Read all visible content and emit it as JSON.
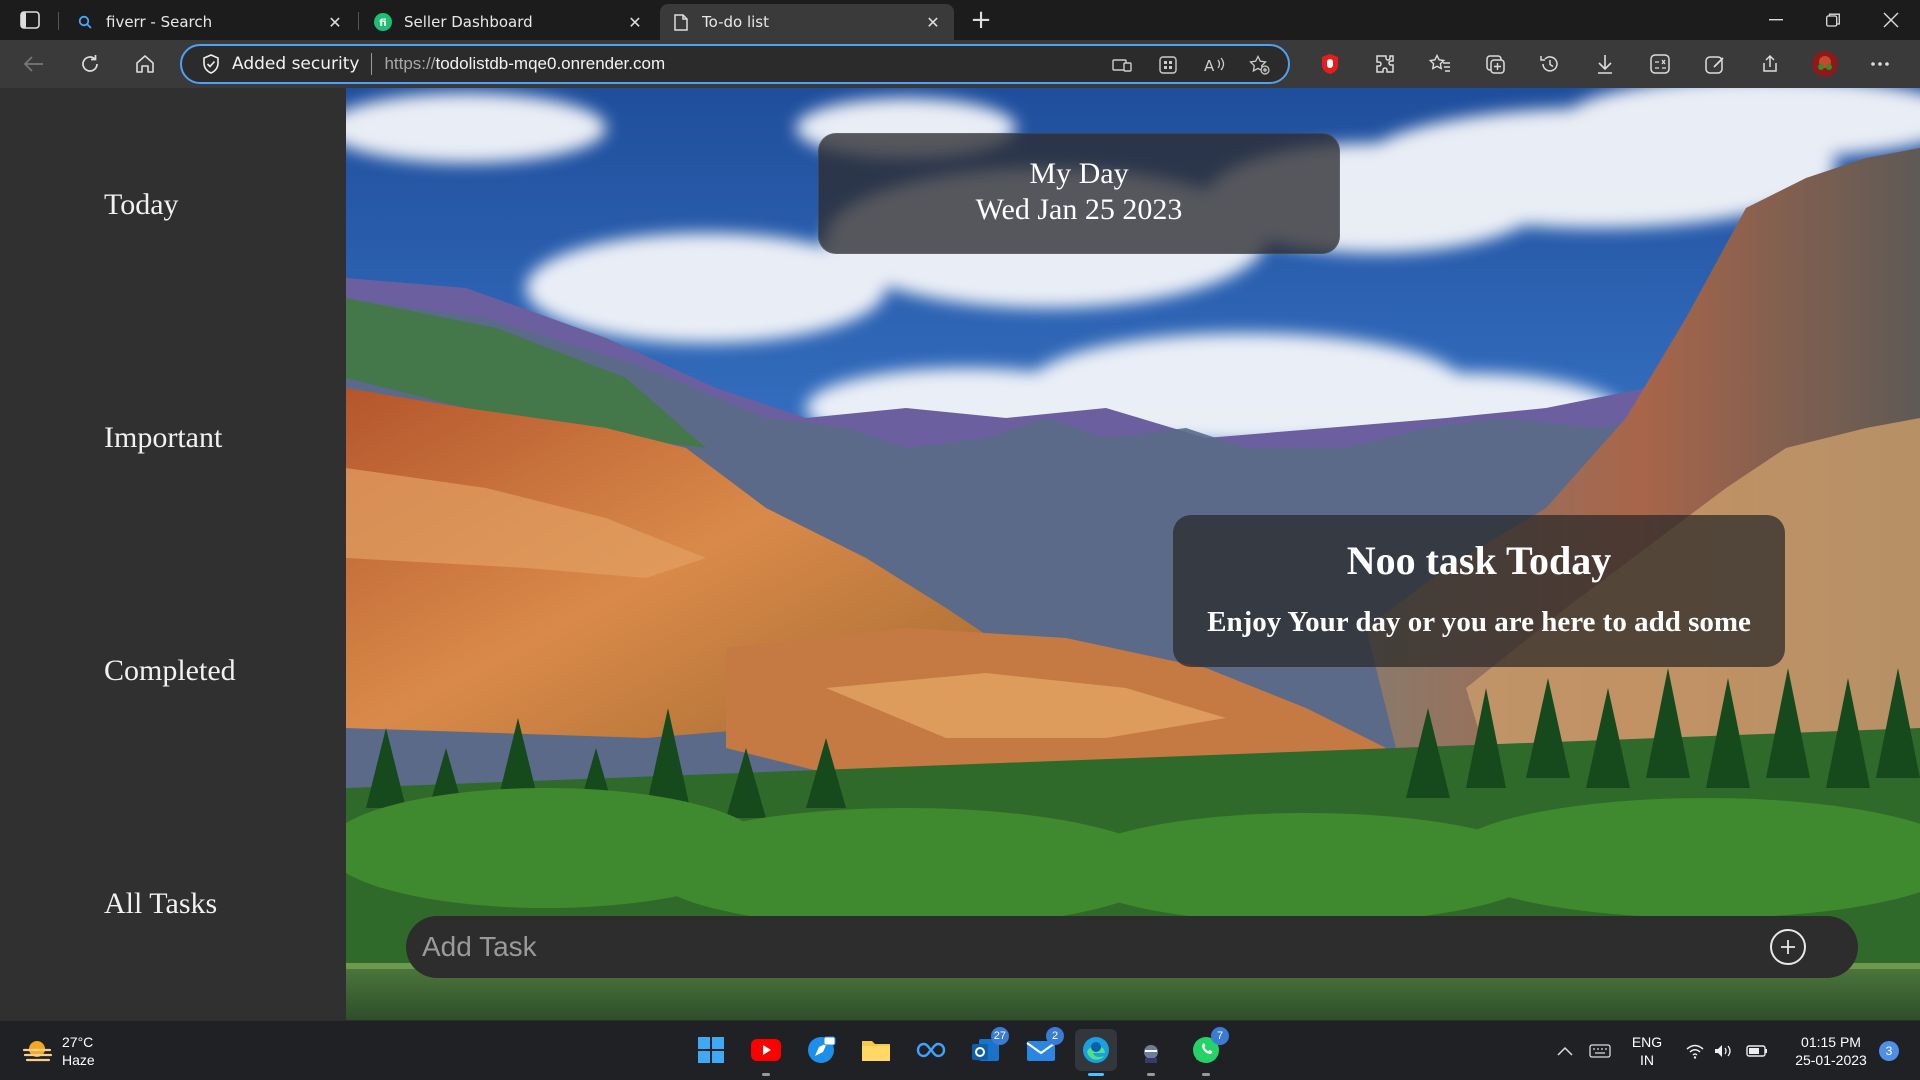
{
  "browser": {
    "tabs": [
      {
        "title": "fiverr - Search",
        "icon": "search-icon",
        "active": false
      },
      {
        "title": "Seller Dashboard",
        "icon": "fiverr-icon",
        "active": false
      },
      {
        "title": "To-do list",
        "icon": "page-icon",
        "active": true
      }
    ],
    "security_label": "Added security",
    "url_scheme": "https://",
    "url_host": "todolistdb-mqe0.onrender.com"
  },
  "sidebar": {
    "items": [
      {
        "label": "Today"
      },
      {
        "label": "Important"
      },
      {
        "label": "Completed"
      },
      {
        "label": "All Tasks"
      }
    ]
  },
  "header": {
    "title": "My Day",
    "date": "Wed Jan 25 2023"
  },
  "empty_state": {
    "heading": "Noo task Today",
    "message": "Enjoy Your day or you are here to add some"
  },
  "add_task": {
    "placeholder": "Add Task"
  },
  "taskbar": {
    "weather": {
      "temp": "27°C",
      "condition": "Haze"
    },
    "apps": [
      {
        "name": "windows-start"
      },
      {
        "name": "youtube"
      },
      {
        "name": "safari-mail"
      },
      {
        "name": "file-explorer"
      },
      {
        "name": "meta"
      },
      {
        "name": "outlook",
        "badge": "27"
      },
      {
        "name": "mail",
        "badge": "2"
      },
      {
        "name": "edge"
      },
      {
        "name": "game"
      },
      {
        "name": "whatsapp",
        "badge": "7"
      }
    ],
    "language": {
      "line1": "ENG",
      "line2": "IN"
    },
    "clock": {
      "time": "01:15 PM",
      "date": "25-01-2023"
    },
    "notification_count": "3"
  }
}
